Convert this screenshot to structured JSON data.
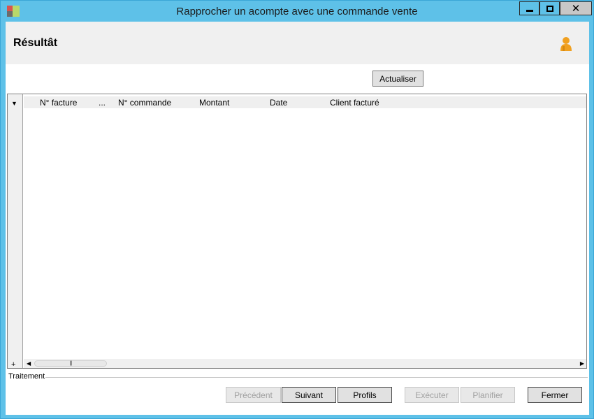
{
  "window": {
    "title": "Rapprocher un acompte avec une commande vente",
    "close_glyph": "✕"
  },
  "header": {
    "title": "Résultât",
    "user_icon": "user-icon"
  },
  "toolbar": {
    "refresh_label": "Actualiser"
  },
  "grid": {
    "columns": [
      "N° facture",
      "...",
      "N° commande",
      "Montant",
      "Date",
      "Client facturé"
    ],
    "rows": [],
    "column_chooser_glyph": "▼",
    "add_glyph": "+",
    "scroll_left_glyph": "◀",
    "scroll_right_glyph": "▶",
    "scroll_grip": "|||"
  },
  "footer": {
    "group_label": "Traitement",
    "buttons": {
      "previous": "Précédent",
      "next": "Suivant",
      "profiles": "Profils",
      "execute": "Exécuter",
      "schedule": "Planifier",
      "close": "Fermer"
    }
  },
  "colors": {
    "titlebar": "#5ec1e8",
    "header_band": "#f0f0f0",
    "user_icon": "#f0a020"
  }
}
